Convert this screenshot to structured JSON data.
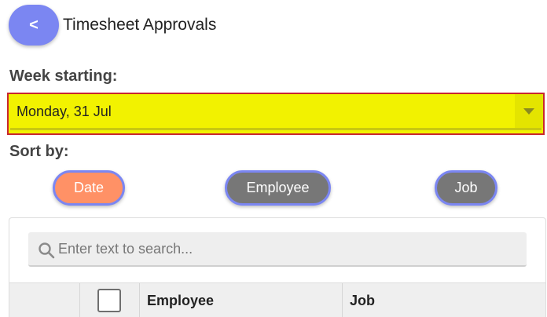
{
  "header": {
    "back_label": "<",
    "title": "Timesheet Approvals"
  },
  "week": {
    "label": "Week starting:",
    "selected": "Monday, 31 Jul"
  },
  "sort": {
    "label": "Sort by:",
    "options": [
      {
        "label": "Date",
        "active": true
      },
      {
        "label": "Employee",
        "active": false
      },
      {
        "label": "Job",
        "active": false
      }
    ]
  },
  "grid": {
    "search_placeholder": "Enter text to search...",
    "columns": [
      "Employee",
      "Job"
    ]
  },
  "colors": {
    "accent": "#7b86f2",
    "active_sort": "#ff9166",
    "inactive_sort": "#777777",
    "select_bg": "#f2f200",
    "select_border": "#c8262e"
  },
  "icons": {
    "search": "search-icon",
    "dropdown": "chevron-down-icon"
  }
}
